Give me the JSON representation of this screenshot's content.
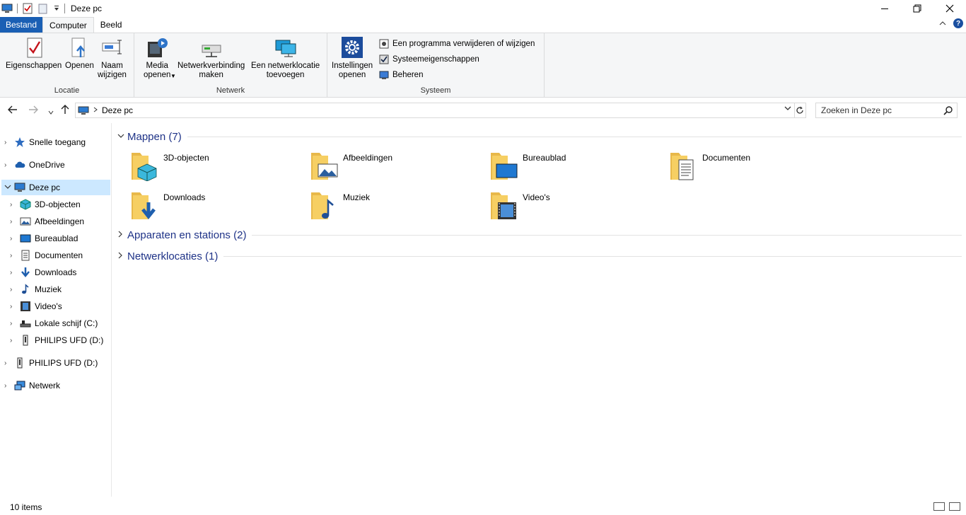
{
  "window": {
    "title": "Deze pc"
  },
  "tabs": [
    {
      "label": "Bestand"
    },
    {
      "label": "Computer"
    },
    {
      "label": "Beeld"
    }
  ],
  "help_label": "?",
  "ribbon": {
    "locatie": {
      "label": "Locatie",
      "eigenschappen": "Eigenschappen",
      "openen": "Openen",
      "naam_l1": "Naam",
      "naam_l2": "wijzigen"
    },
    "netwerk": {
      "label": "Netwerk",
      "media_l1": "Media",
      "media_l2": "openen",
      "netverb_l1": "Netwerkverbinding",
      "netverb_l2": "maken",
      "netloc_l1": "Een netwerklocatie",
      "netloc_l2": "toevoegen"
    },
    "systeem": {
      "label": "Systeem",
      "inst_l1": "Instellingen",
      "inst_l2": "openen",
      "programma": "Een programma verwijderen of wijzigen",
      "sysprop": "Systeemeigenschappen",
      "beheren": "Beheren"
    }
  },
  "address": {
    "path": "Deze pc"
  },
  "search": {
    "placeholder": "Zoeken in Deze pc"
  },
  "nav": {
    "snelle": "Snelle toegang",
    "onedrive": "OneDrive",
    "dezepc": "Deze pc",
    "objecten": "3D-objecten",
    "afbeeldingen": "Afbeeldingen",
    "bureaublad": "Bureaublad",
    "documenten": "Documenten",
    "downloads": "Downloads",
    "muziek": "Muziek",
    "videos": "Video's",
    "lokale": "Lokale schijf (C:)",
    "philips_sub": "PHILIPS UFD (D:)",
    "philips": "PHILIPS UFD (D:)",
    "netwerk": "Netwerk"
  },
  "sections": {
    "mappen": "Mappen (7)",
    "apparaten": "Apparaten en stations (2)",
    "netwerklocaties": "Netwerklocaties (1)"
  },
  "folders": [
    {
      "name": "3D-objecten"
    },
    {
      "name": "Afbeeldingen"
    },
    {
      "name": "Bureaublad"
    },
    {
      "name": "Documenten"
    },
    {
      "name": "Downloads"
    },
    {
      "name": "Muziek"
    },
    {
      "name": "Video's"
    }
  ],
  "status": {
    "count": "10 items"
  },
  "colors": {
    "accent": "#1a5fb4",
    "folder": "#f3c85a",
    "selection": "#cce8ff",
    "section_title": "#1e3287"
  }
}
